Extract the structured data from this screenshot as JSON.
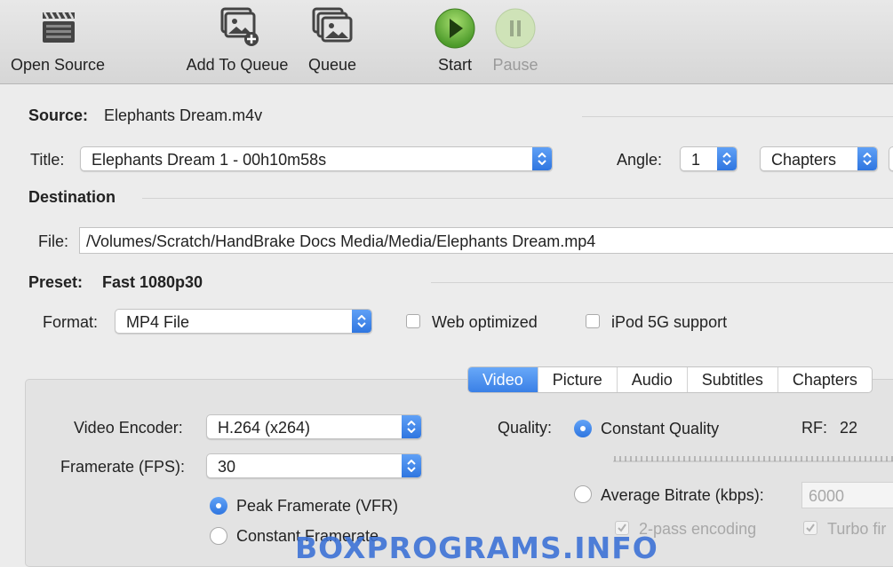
{
  "toolbar": {
    "open_source": "Open Source",
    "add_to_queue": "Add To Queue",
    "queue": "Queue",
    "start": "Start",
    "pause": "Pause"
  },
  "source": {
    "label": "Source:",
    "value": "Elephants Dream.m4v"
  },
  "title": {
    "label": "Title:",
    "value": "Elephants Dream 1 - 00h10m58s"
  },
  "angle": {
    "label": "Angle:",
    "value": "1"
  },
  "range": {
    "value": "Chapters"
  },
  "destination": {
    "heading": "Destination",
    "file_label": "File:",
    "file_value": "/Volumes/Scratch/HandBrake Docs Media/Media/Elephants Dream.mp4"
  },
  "preset": {
    "label": "Preset:",
    "value": "Fast 1080p30"
  },
  "format": {
    "label": "Format:",
    "value": "MP4 File",
    "web_optimized": "Web optimized",
    "ipod_support": "iPod 5G support"
  },
  "tabs": [
    "Video",
    "Picture",
    "Audio",
    "Subtitles",
    "Chapters"
  ],
  "video": {
    "encoder_label": "Video Encoder:",
    "encoder_value": "H.264 (x264)",
    "framerate_label": "Framerate (FPS):",
    "framerate_value": "30",
    "peak_framerate": "Peak Framerate (VFR)",
    "constant_framerate": "Constant Framerate",
    "quality_label": "Quality:",
    "constant_quality": "Constant Quality",
    "rf_label": "RF:",
    "rf_value": "22",
    "average_bitrate": "Average Bitrate (kbps):",
    "bitrate_value": "6000",
    "two_pass": "2-pass encoding",
    "turbo": "Turbo fir"
  },
  "watermark": "BOXPROGRAMS.INFO",
  "colors": {
    "accent": "#3a80e6",
    "start_green": "#5fb33a",
    "watermark": "#3d73d6"
  }
}
